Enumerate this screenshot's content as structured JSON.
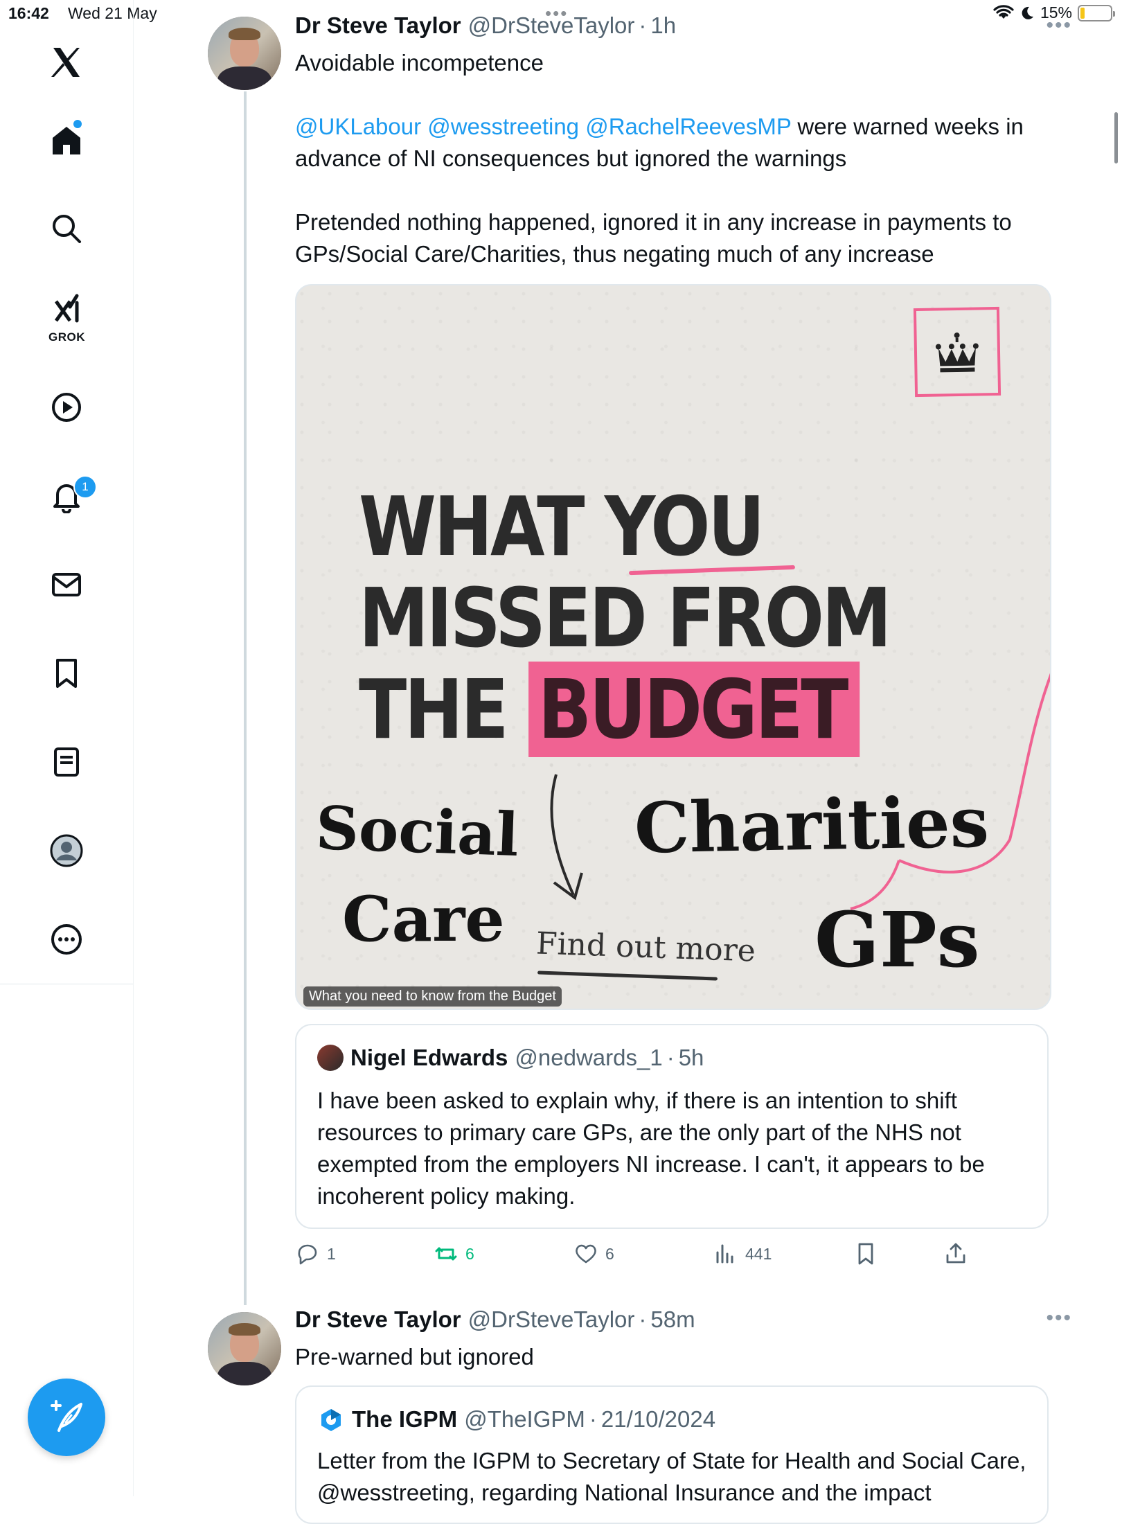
{
  "status_bar": {
    "time": "16:42",
    "date": "Wed 21 May",
    "battery_percent": "15%",
    "battery_level": 0.15,
    "multitask_dots": "•••"
  },
  "sidebar": {
    "grok_label": "GROK",
    "notifications_badge": "1",
    "items": [
      "x-logo",
      "home-icon",
      "search-icon",
      "grok-icon",
      "video-icon",
      "bell-icon",
      "mail-icon",
      "bookmark-icon",
      "lists-icon",
      "profile-icon",
      "more-icon"
    ],
    "accent": "#1d9bf0"
  },
  "tweets": [
    {
      "author": "Dr Steve Taylor",
      "handle": "@DrSteveTaylor",
      "separator": "·",
      "time": "1h",
      "more": "•••",
      "line1": "Avoidable incompetence",
      "mention1": "@UKLabour",
      "mention2": "@wesstreeting",
      "mention3": "@RachelReevesMP",
      "text_after_mentions": "were warned weeks in advance of NI consequences but ignored the warnings",
      "paragraph3": "Pretended nothing happened, ignored it in any increase in payments to GPs/Social Care/Charities, thus negating much of any increase",
      "media": {
        "headline_line1": "WHAT YOU",
        "headline_line2": "MISSED FROM",
        "headline_the": "THE",
        "headline_budget": "BUDGET",
        "hand_social": "Social",
        "hand_care": "Care",
        "hand_charities": "Charities",
        "hand_gps": "GPs",
        "hand_find": "Find out more",
        "caption": "What you need to know from the Budget",
        "highlight_color": "#f06292"
      },
      "quote": {
        "author": "Nigel Edwards",
        "handle": "@nedwards_1",
        "separator": "·",
        "time": "5h",
        "text": "I have been asked to explain why, if there is an intention to shift resources to primary care GPs, are the only part of the NHS not exempted from the employers NI increase.   I can't, it appears to be incoherent policy making."
      },
      "actions": {
        "replies": "1",
        "retweets": "6",
        "likes": "6",
        "views": "441"
      }
    },
    {
      "author": "Dr Steve Taylor",
      "handle": "@DrSteveTaylor",
      "separator": "·",
      "time": "58m",
      "more": "•••",
      "text": "Pre-warned but ignored",
      "quote": {
        "author": "The IGPM",
        "handle": "@TheIGPM",
        "separator": "·",
        "time": "21/10/2024",
        "text": "Letter from the IGPM to Secretary of State for Health and Social Care, @wesstreeting, regarding National Insurance and the impact"
      }
    }
  ]
}
